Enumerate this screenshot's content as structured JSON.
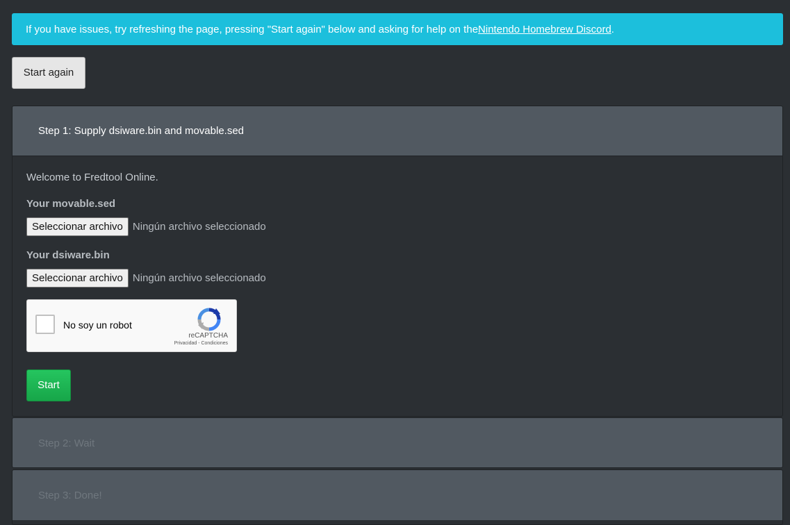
{
  "alert": {
    "text_before": "If you have issues, try refreshing the page, pressing \"Start again\" below and asking for help on the ",
    "link_text": "Nintendo Homebrew Discord",
    "text_after": "."
  },
  "start_again_label": "Start again",
  "step1": {
    "title": "Step 1: Supply dsiware.bin and movable.sed",
    "welcome": "Welcome to Fredtool Online.",
    "movable_label": "Your movable.sed",
    "dsiware_label": "Your dsiware.bin",
    "file_button": "Seleccionar archivo",
    "file_status": "Ningún archivo seleccionado",
    "captcha": {
      "checkbox_label": "No soy un robot",
      "brand": "reCAPTCHA",
      "terms": "Privacidad - Condiciones"
    },
    "start_label": "Start"
  },
  "step2": {
    "title": "Step 2: Wait"
  },
  "step3": {
    "title": "Step 3: Done!"
  },
  "colors": {
    "alert_bg": "#1cbfdc",
    "panel_heading_bg": "#515961",
    "page_bg": "#2b2f33",
    "start_green": "#1db954"
  }
}
